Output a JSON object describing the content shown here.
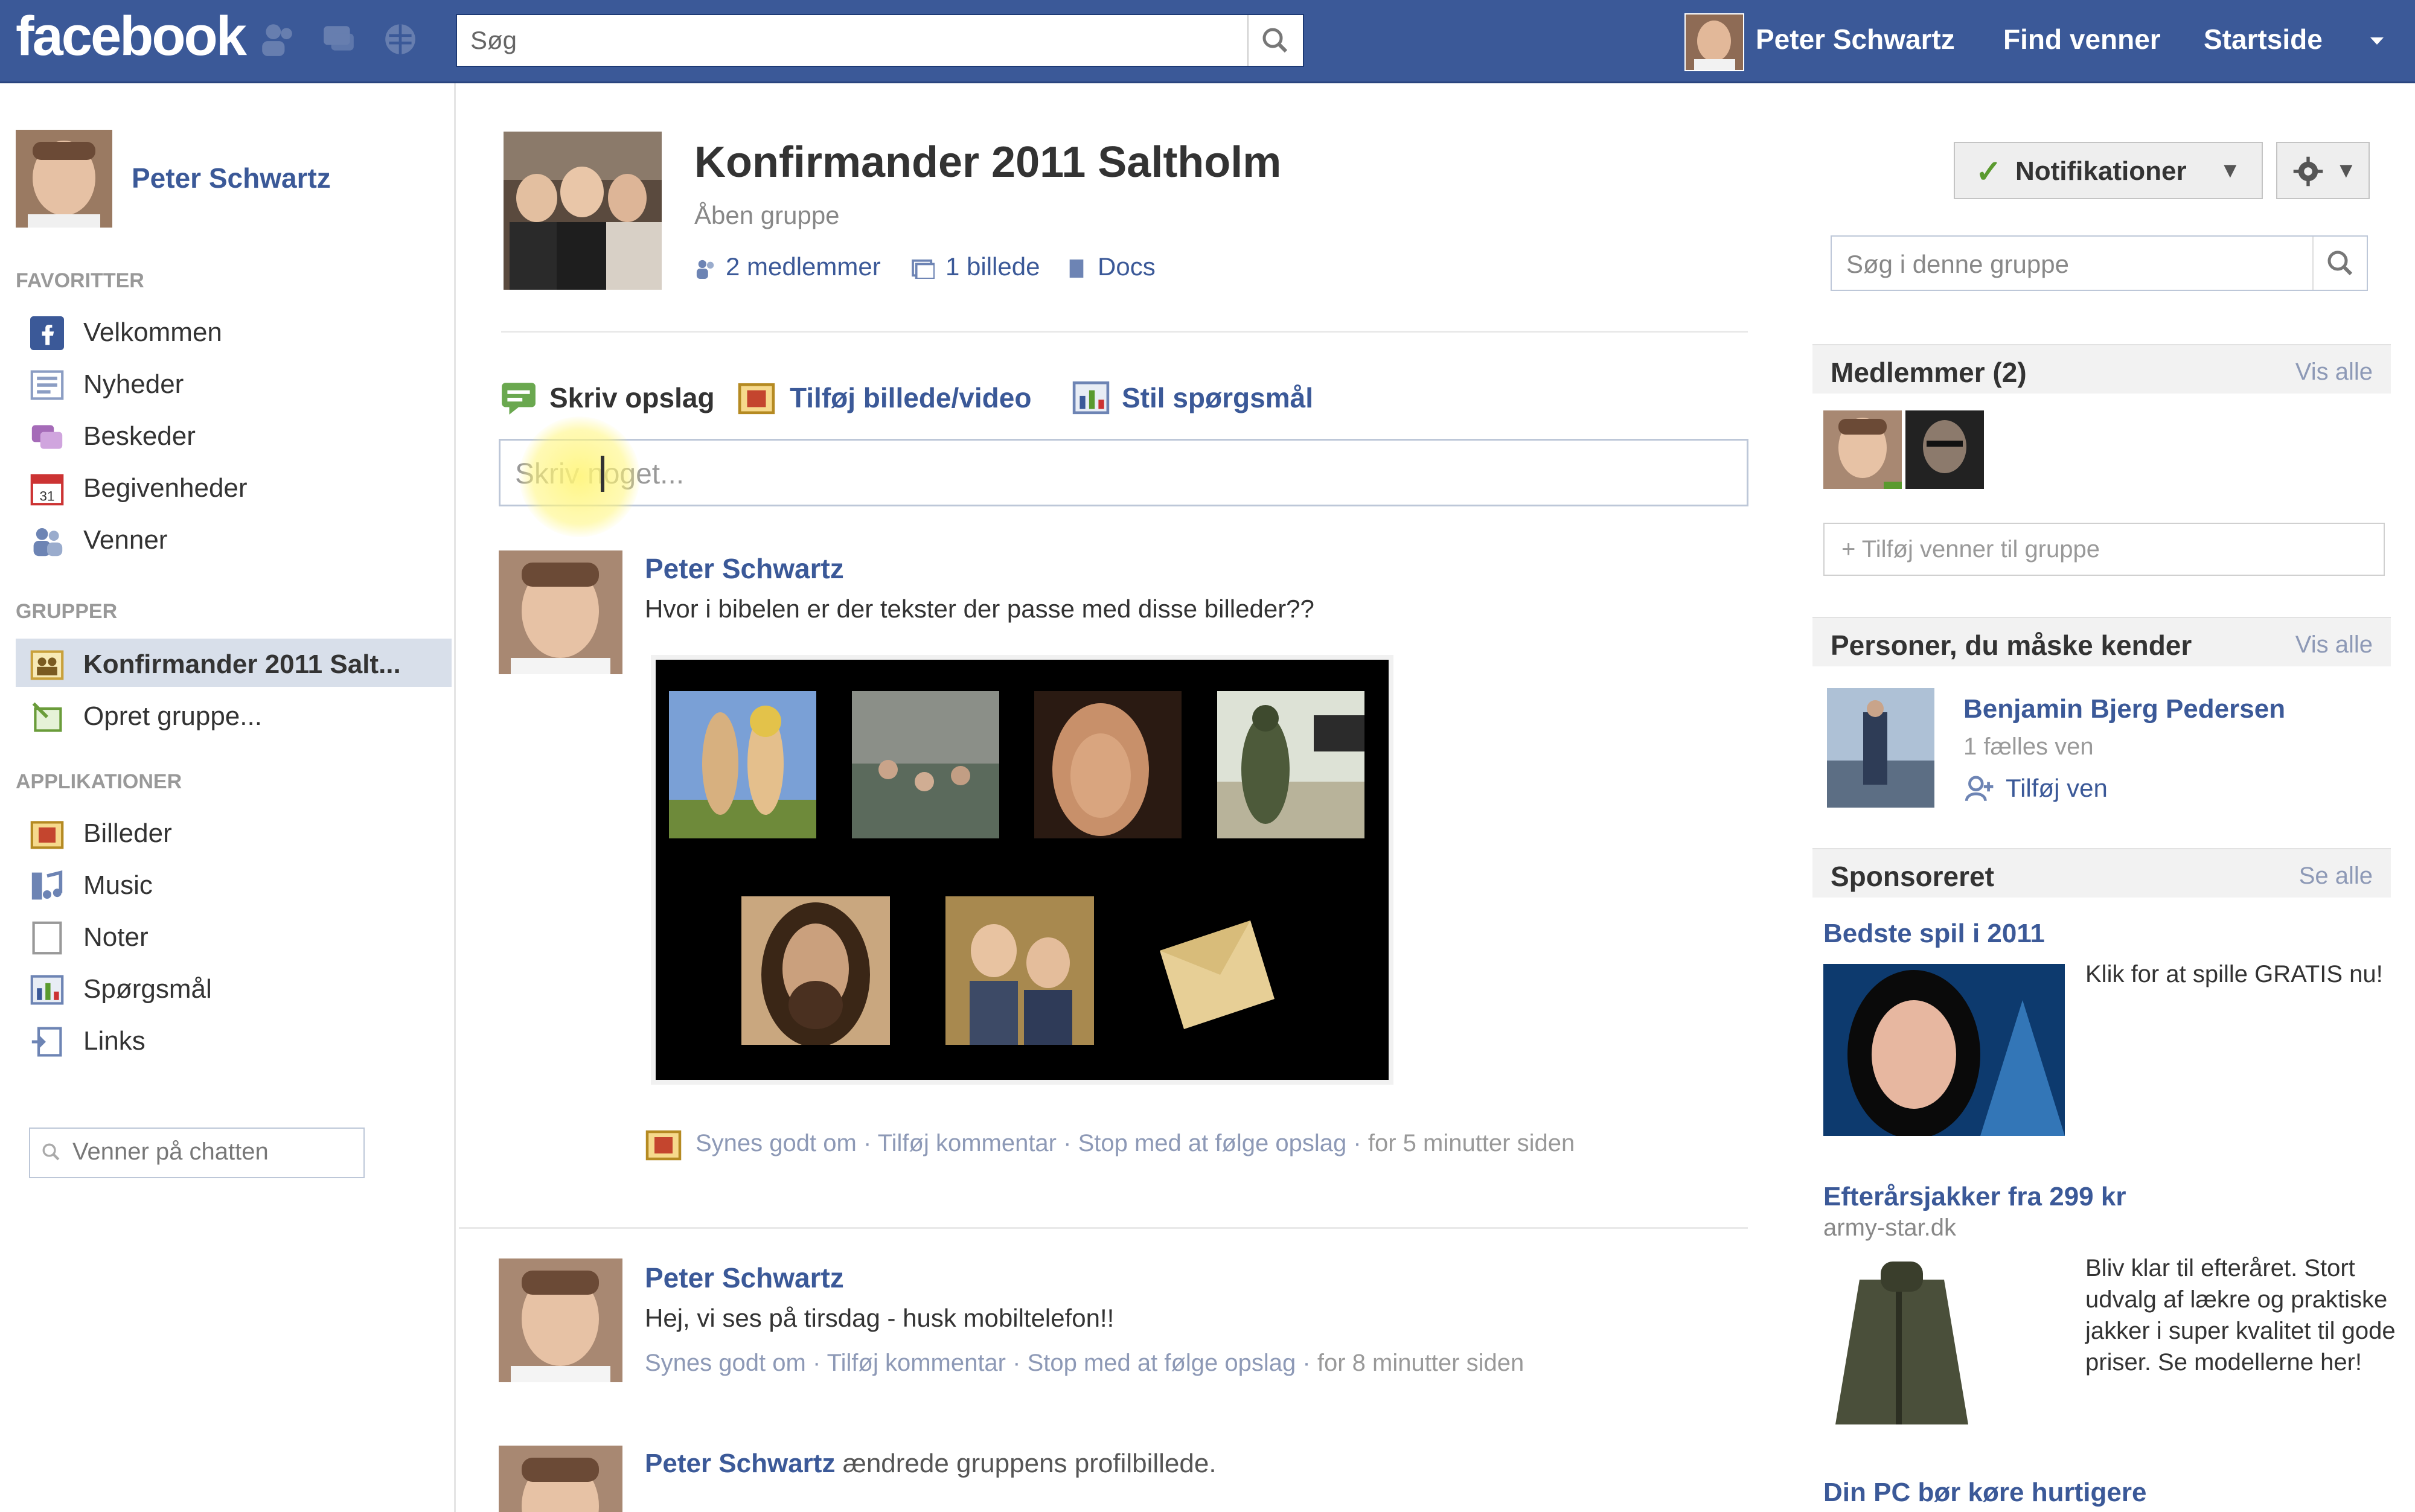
{
  "header": {
    "logo": "facebook",
    "search_placeholder": "Søg",
    "user_name": "Peter Schwartz",
    "find_friends": "Find venner",
    "home": "Startside"
  },
  "sidebar": {
    "user_name": "Peter Schwartz",
    "favorites_heading": "FAVORITTER",
    "favorites": [
      {
        "label": "Velkommen",
        "icon": "facebook-icon"
      },
      {
        "label": "Nyheder",
        "icon": "news-feed-icon"
      },
      {
        "label": "Beskeder",
        "icon": "messages-icon"
      },
      {
        "label": "Begivenheder",
        "icon": "events-icon"
      },
      {
        "label": "Venner",
        "icon": "friends-icon"
      }
    ],
    "groups_heading": "GRUPPER",
    "groups": [
      {
        "label": "Konfirmander 2011 Salt...",
        "icon": "group-icon"
      },
      {
        "label": "Opret gruppe...",
        "icon": "create-group-icon"
      }
    ],
    "apps_heading": "APPLIKATIONER",
    "apps": [
      {
        "label": "Billeder",
        "icon": "photos-icon"
      },
      {
        "label": "Music",
        "icon": "music-icon"
      },
      {
        "label": "Noter",
        "icon": "notes-icon"
      },
      {
        "label": "Spørgsmål",
        "icon": "questions-icon"
      },
      {
        "label": "Links",
        "icon": "links-icon"
      }
    ],
    "chat_placeholder": "Venner på chatten"
  },
  "group": {
    "title": "Konfirmander 2011 Saltholm",
    "type": "Åben gruppe",
    "members_link": "2 medlemmer",
    "photos_link": "1 billede",
    "docs_link": "Docs"
  },
  "composer": {
    "tab_post": "Skriv opslag",
    "tab_photo": "Tilføj billede/video",
    "tab_question": "Stil spørgsmål",
    "placeholder": "Skriv noget..."
  },
  "posts": [
    {
      "author": "Peter Schwartz",
      "text": "Hvor i bibelen er der tekster der passe med disse billeder??",
      "like": "Synes godt om",
      "comment": "Tilføj kommentar",
      "unfollow": "Stop med at følge opslag",
      "time": "for 5 minutter siden"
    },
    {
      "author": "Peter Schwartz",
      "text": "Hej, vi ses på tirsdag - husk mobiltelefon!!",
      "like": "Synes godt om",
      "comment": "Tilføj kommentar",
      "unfollow": "Stop med at følge opslag",
      "time": "for 8 minutter siden"
    },
    {
      "author": "Peter Schwartz",
      "text": "ændrede gruppens profilbillede."
    }
  ],
  "right": {
    "notifications_label": "Notifikationer",
    "group_search_placeholder": "Søg i denne gruppe",
    "members_title": "Medlemmer (2)",
    "members_see_all": "Vis alle",
    "add_friends_placeholder": "+ Tilføj venner til gruppe",
    "pymk_title": "Personer, du måske kender",
    "pymk_see_all": "Vis alle",
    "pymk_name": "Benjamin Bjerg Pedersen",
    "pymk_mutual": "1 fælles ven",
    "pymk_add": "Tilføj ven",
    "sponsored_title": "Sponsoreret",
    "sponsored_see_all": "Se alle",
    "ads": [
      {
        "title": "Bedste spil i 2011",
        "body": "Klik for at spille GRATIS nu!"
      },
      {
        "title": "Efterårsjakker fra 299 kr",
        "url": "army-star.dk",
        "body": "Bliv klar til efteråret. Stort udvalg af lækre og praktiske jakker i super kvalitet til gode priser. Se modellerne her!"
      },
      {
        "title": "Din PC bør køre hurtigere"
      }
    ]
  },
  "colors": {
    "brand_blue": "#3b5998",
    "link_blue": "#3b5998",
    "muted_link": "#8d99b6",
    "active_nav": "#d8dfea"
  }
}
